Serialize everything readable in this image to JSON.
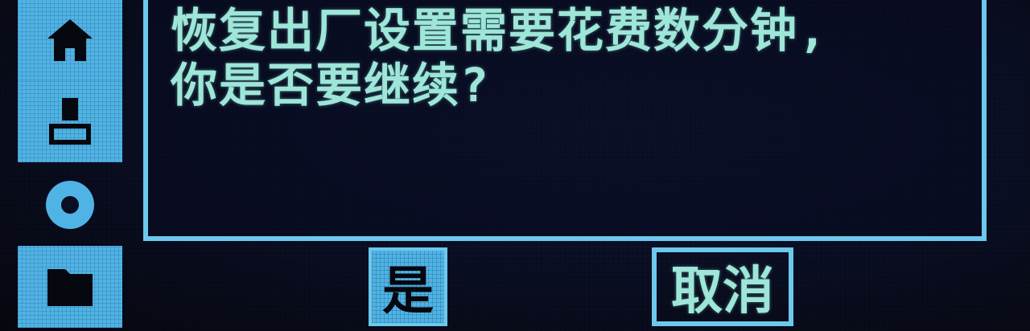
{
  "sidebar": {
    "items": [
      {
        "icon": "home-icon",
        "active": true
      },
      {
        "icon": "user-icon",
        "active": true
      },
      {
        "icon": "gear-icon",
        "active": false
      },
      {
        "icon": "folder-icon",
        "active": true
      }
    ]
  },
  "dialog": {
    "message_line1": "恢复出厂设置需要花费数分钟,",
    "message_line2": "你是否要继续?"
  },
  "buttons": {
    "confirm_label": "是",
    "cancel_label": "取消"
  },
  "colors": {
    "accent": "#4fb3e6",
    "border": "#6cc8ec",
    "text": "#9ee6d8",
    "background": "#0a0e22"
  }
}
